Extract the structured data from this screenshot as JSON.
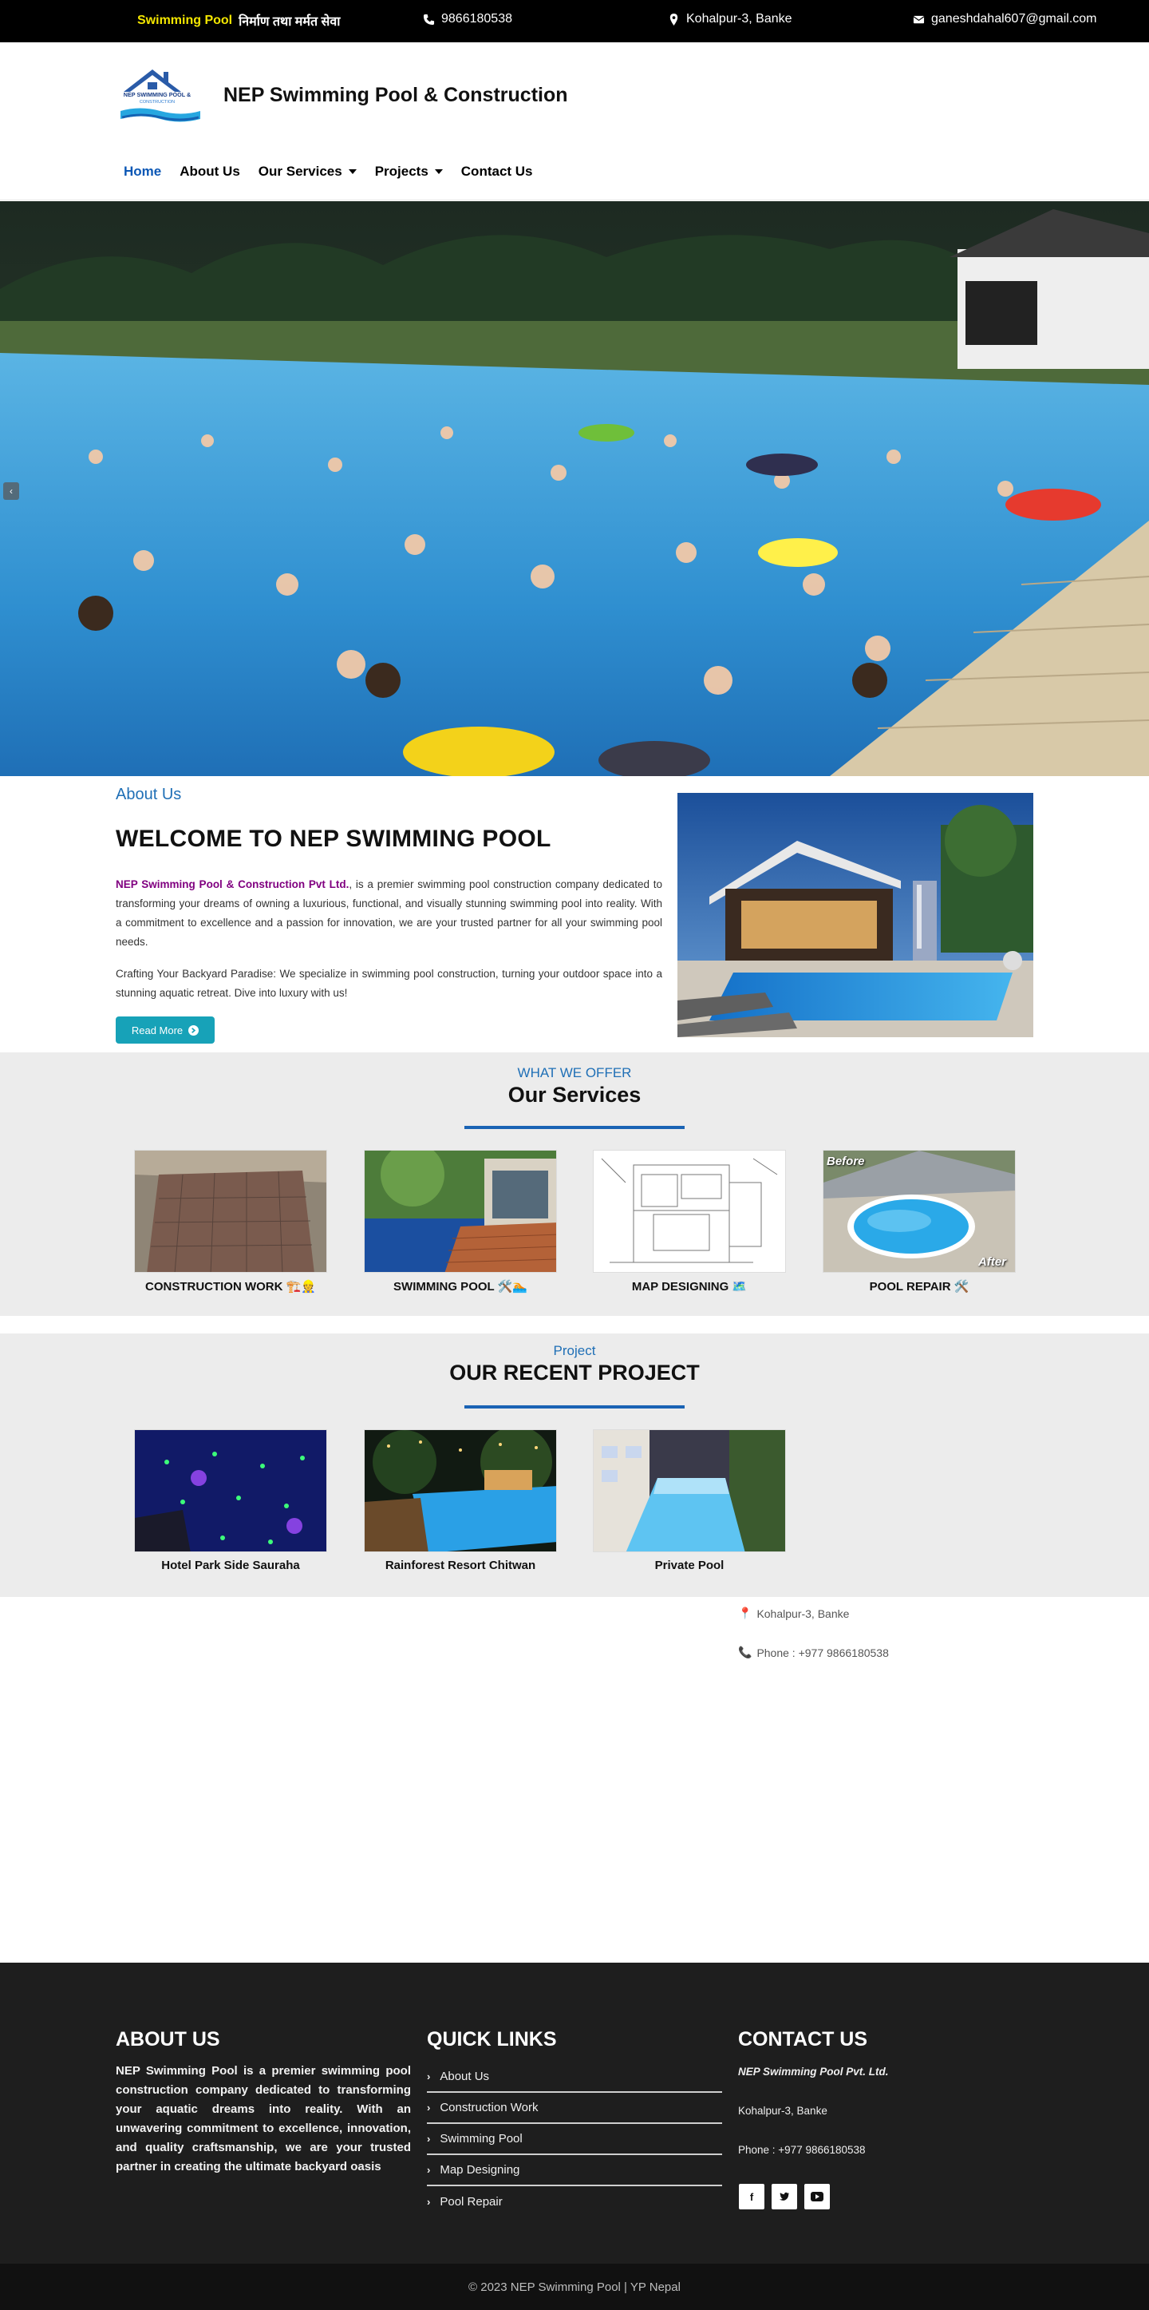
{
  "topbar": {
    "slogan_highlight": "Swimming Pool",
    "slogan_rest": "निर्माण तथा मर्मत सेवा",
    "phone": "9866180538",
    "address": "Kohalpur-3, Banke",
    "email": "ganeshdahal607@gmail.com"
  },
  "header": {
    "logo_text": "NEP SWIMMING POOL & CONSTRUCTION",
    "brand": "NEP Swimming Pool & Construction",
    "nav": [
      {
        "label": "Home",
        "active": true
      },
      {
        "label": "About Us"
      },
      {
        "label": "Our Services",
        "dropdown": true
      },
      {
        "label": "Projects",
        "dropdown": true
      },
      {
        "label": "Contact Us"
      }
    ]
  },
  "about": {
    "label": "About Us",
    "title": "WELCOME TO NEP SWIMMING POOL",
    "company": "NEP Swimming Pool & Construction Pvt Ltd.",
    "p1_rest": ", is a premier swimming pool construction company dedicated to transforming your dreams of owning a luxurious, functional, and visually stunning swimming pool into reality. With a commitment to excellence and a passion for innovation, we are your trusted partner for all your swimming pool needs.",
    "p2": "Crafting Your Backyard Paradise: We specialize in swimming pool construction, turning your outdoor space into a stunning aquatic retreat. Dive into luxury with us!",
    "read_more": "Read More"
  },
  "services": {
    "kicker": "WHAT WE OFFER",
    "title": "Our Services",
    "items": [
      {
        "caption": "CONSTRUCTION WORK 🏗️👷"
      },
      {
        "caption": "SWIMMING POOL 🛠️🏊"
      },
      {
        "caption": "MAP DESIGNING 🗺️"
      },
      {
        "caption": "POOL REPAIR 🛠️"
      }
    ],
    "repair_before": "Before",
    "repair_after": "After"
  },
  "projects": {
    "kicker": "Project",
    "title": "OUR RECENT PROJECT",
    "items": [
      {
        "caption": "Hotel Park Side Sauraha"
      },
      {
        "caption": "Rainforest Resort Chitwan"
      },
      {
        "caption": "Private Pool"
      }
    ]
  },
  "contact_strip": {
    "address": "Kohalpur-3, Banke",
    "phone": "Phone : +977 9866180538"
  },
  "footer": {
    "about_heading": "ABOUT US",
    "about_text": "NEP Swimming Pool is a premier swimming pool construction company dedicated to transforming your aquatic dreams into reality. With an unwavering commitment to excellence, innovation, and quality craftsmanship, we are your trusted partner in creating the ultimate backyard oasis",
    "links_heading": "QUICK  LINKS",
    "links": [
      "About Us",
      "Construction Work",
      "Swimming Pool",
      "Map Designing",
      "Pool Repair"
    ],
    "contact_heading": "CONTACT US",
    "company": "NEP Swimming Pool Pvt. Ltd.",
    "address": "Kohalpur-3, Banke",
    "phone": "Phone : +977 9866180538",
    "social": [
      {
        "icon": "facebook-icon",
        "glyph": "f"
      },
      {
        "icon": "twitter-icon",
        "glyph": "🐦"
      },
      {
        "icon": "youtube-icon",
        "glyph": "▶"
      }
    ]
  },
  "copyright": "© 2023 NEP Swimming Pool | YP Nepal",
  "colors": {
    "accent_blue": "#1f6fb6",
    "nav_active": "#0b57b5",
    "button_teal": "#17a2b8",
    "slogan_yellow": "#f3e600",
    "footer_bg": "#1e1e1e"
  }
}
